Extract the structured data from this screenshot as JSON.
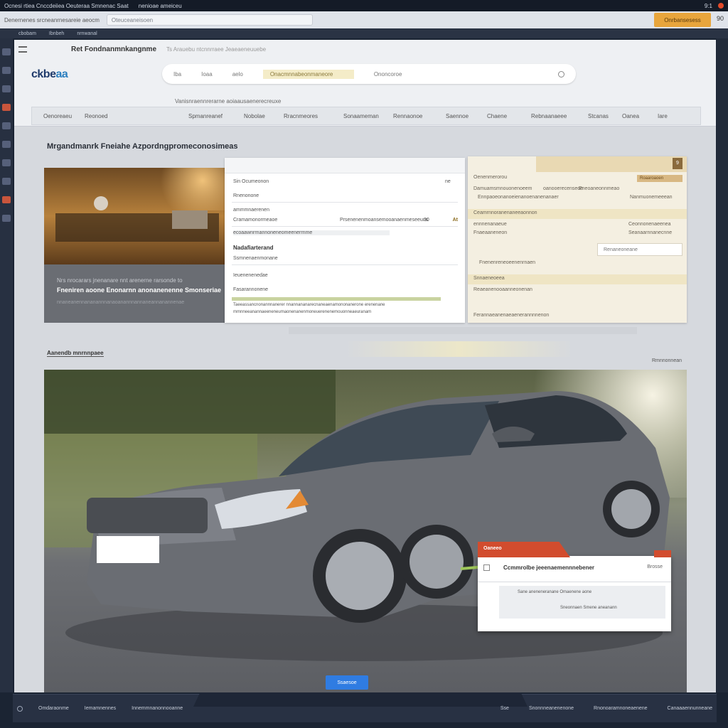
{
  "os_bar": {
    "left_text": "Ocnesi rtiea Cnccdeiiea Oeuteraa Smnenac Saat",
    "mid_text": "nenioae ameiceu",
    "right_time": "9:1"
  },
  "browser": {
    "tab_text": "Denernenes srcneanrnesareie aeocm",
    "url": "Oteuceaneisoen",
    "accent_button": "Onrbansesess",
    "ext_label": "90"
  },
  "bookmarks": [
    "cbobam",
    "Ibnbeh",
    "nrnwanal"
  ],
  "page": {
    "tab_title": "Ret Fondnanmnkangnme",
    "tab_sub": "Ts Arauebu ntcnnrraee Jeaeaeneuuebe",
    "logo_main": "ckbe",
    "logo_accent": "aa",
    "search": {
      "field1": "Iba",
      "field2": "Ioaa",
      "field3": "aelo",
      "highlight": "Onacmnnabeonmaneore",
      "field4": "Ononcoroe"
    },
    "breadcrumb": "Vanisnraennrerarne aoiaausaenerecreuxe",
    "nav": [
      "Oenoreaeu",
      "Reonoed",
      "Spmanreanef",
      "Nobolae",
      "Rracnmeores",
      "Sonaameman",
      "Rennaonoe",
      "Saennoe",
      "Chaene",
      "Rebnaanaeee",
      "Stcanas",
      "Oanea",
      "Iare"
    ]
  },
  "section_title": "Mrgandmanrk Fneiahe Azpordngpromeconosimeas",
  "shop_card": {
    "caption1": "Nrs nrocarars jnenanare nnt arenerne rarsonde to",
    "caption2": "Fneniren aoone Enonarnn anonanenenne Smonseriae",
    "caption3": "nnaneanennananannnanaoanannnannaneannanannenae"
  },
  "form_card": {
    "r1": "Sin Ocumeonon",
    "r1_right": "ne",
    "r2": "Rnenonone",
    "r3": "ammmnaerenen",
    "r4_left": "Cramamonormeaoe",
    "r4_mid": "Prsenenenmoansemooanaenmeseeuns",
    "r4_num": "30",
    "r4_tag": "At",
    "r5": "ecoaawnrrnannoneneomeenerrnme",
    "r6": "Nadafiarterand",
    "r7": "Ssmnenaenmonane",
    "r8": "Ieuenenenedae",
    "r9": "Fasarannonene",
    "r10": "Taeeassancnonannnanerer nnannananarecnaneaenamononanerone erenenane",
    "r11": "mmnneeanannaeeneneumaonenanenmoneuerenenemouonneaeuranam"
  },
  "report_card": {
    "badge": "9",
    "r1": "Oenenmerorou",
    "tag": "Roaaroaoen",
    "r2_left": "Damuamsmnouonenoeem",
    "r2_mid": "oanooerecenseoe",
    "r2_right": "Eneoaneonnmeao",
    "r3": "Ennpaoeonanoeienanoenanenanaer",
    "r3_right": "Nanmuonemeeean",
    "r4": "Ceamrnnoranenaneeaonnon",
    "r5_left": "ennnenanaeue",
    "r5_right": "Ceonnonenaeenea",
    "r6": "Fnaeaaneneon",
    "r6_right": "Seanaarnnanecnne",
    "pill": "Renaneoneane",
    "r7": "Fnenenreneoeenenrnaen",
    "r8": "Snnaeneoeea",
    "r9": "Reaeanenooaanneonenan",
    "r10": "Ferannaeanenaeaenerannnnenon"
  },
  "section2": {
    "title": "Aanendb mnrnnpaee",
    "right": "Rmnnonnean"
  },
  "overlay": {
    "tab": "Oaneeo",
    "title": "Ccmmrolbe jeeenaemennnebener",
    "right": "Brosse",
    "line1": "Sane aneneneranane Omaenene aone",
    "line2": "Sneonnaen Smene aneanann"
  },
  "blue_button": "Ssaesoe",
  "status_bar": {
    "item1": "Omdaraonme",
    "item2": "Iemamnennes",
    "item3": "Innemmnanonnooanne",
    "item4": "Sse",
    "item5": "Snonnneanenenone",
    "item6": "Rnonoaramnoneaenene",
    "item7": "Canaaaennunneane"
  },
  "colors": {
    "accent": "#e8a53c",
    "brand": "#1f3a6b",
    "alert": "#d24c2e",
    "primary_button": "#2f7ce2"
  }
}
